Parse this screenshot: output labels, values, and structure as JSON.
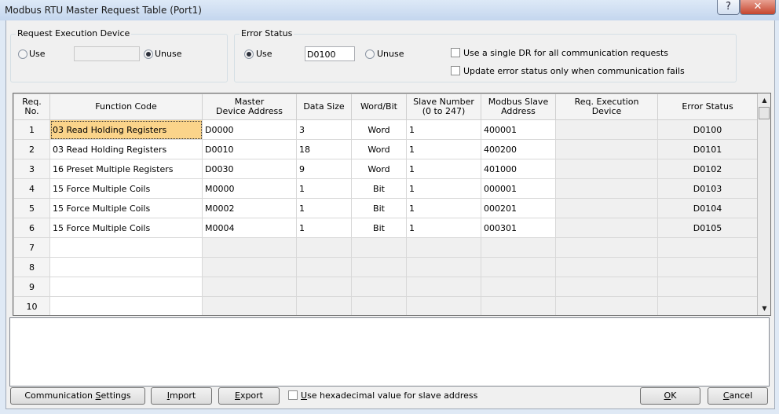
{
  "window": {
    "title": "Modbus RTU Master Request Table (Port1)",
    "help_label": "?",
    "close_label": "✕"
  },
  "request_execution_device": {
    "legend": "Request Execution Device",
    "use_label": "Use",
    "unuse_label": "Unuse",
    "device_value": ""
  },
  "error_status": {
    "legend": "Error Status",
    "use_label": "Use",
    "unuse_label": "Unuse",
    "device_value": "D0100",
    "single_dr_label": "Use a single DR for all communication requests",
    "update_fail_label": "Update error status only when communication fails"
  },
  "table": {
    "headers": {
      "req_no": [
        "Req.",
        "No."
      ],
      "function_code": "Function Code",
      "master_addr": [
        "Master",
        "Device Address"
      ],
      "data_size": "Data Size",
      "word_bit": "Word/Bit",
      "slave_number": [
        "Slave Number",
        "(0 to 247)"
      ],
      "modbus_slave": [
        "Modbus Slave",
        "Address"
      ],
      "req_exec": [
        "Req. Execution",
        "Device"
      ],
      "error_status": "Error Status"
    },
    "rows": [
      {
        "no": "1",
        "function": "03 Read Holding Registers",
        "master": "D0000",
        "size": "3",
        "wordbit": "Word",
        "slave": "1",
        "modbus": "400001",
        "req": "",
        "err": "D0100"
      },
      {
        "no": "2",
        "function": "03 Read Holding Registers",
        "master": "D0010",
        "size": "18",
        "wordbit": "Word",
        "slave": "1",
        "modbus": "400200",
        "req": "",
        "err": "D0101"
      },
      {
        "no": "3",
        "function": "16 Preset Multiple Registers",
        "master": "D0030",
        "size": "9",
        "wordbit": "Word",
        "slave": "1",
        "modbus": "401000",
        "req": "",
        "err": "D0102"
      },
      {
        "no": "4",
        "function": "15 Force Multiple Coils",
        "master": "M0000",
        "size": "1",
        "wordbit": "Bit",
        "slave": "1",
        "modbus": "000001",
        "req": "",
        "err": "D0103"
      },
      {
        "no": "5",
        "function": "15 Force Multiple Coils",
        "master": "M0002",
        "size": "1",
        "wordbit": "Bit",
        "slave": "1",
        "modbus": "000201",
        "req": "",
        "err": "D0104"
      },
      {
        "no": "6",
        "function": "15 Force Multiple Coils",
        "master": "M0004",
        "size": "1",
        "wordbit": "Bit",
        "slave": "1",
        "modbus": "000301",
        "req": "",
        "err": "D0105"
      },
      {
        "no": "7",
        "function": "",
        "master": "",
        "size": "",
        "wordbit": "",
        "slave": "",
        "modbus": "",
        "req": "",
        "err": ""
      },
      {
        "no": "8",
        "function": "",
        "master": "",
        "size": "",
        "wordbit": "",
        "slave": "",
        "modbus": "",
        "req": "",
        "err": ""
      },
      {
        "no": "9",
        "function": "",
        "master": "",
        "size": "",
        "wordbit": "",
        "slave": "",
        "modbus": "",
        "req": "",
        "err": ""
      },
      {
        "no": "10",
        "function": "",
        "master": "",
        "size": "",
        "wordbit": "",
        "slave": "",
        "modbus": "",
        "req": "",
        "err": ""
      }
    ]
  },
  "buttons": {
    "comm_settings": {
      "pre": "Communication ",
      "mn": "S",
      "post": "ettings"
    },
    "import": {
      "pre": "",
      "mn": "I",
      "post": "mport"
    },
    "export": {
      "pre": "",
      "mn": "E",
      "post": "xport"
    },
    "ok": {
      "pre": "",
      "mn": "O",
      "post": "K"
    },
    "cancel": {
      "pre": "",
      "mn": "C",
      "post": "ancel"
    }
  },
  "hex_checkbox": {
    "pre": "",
    "mn": "U",
    "post": "se hexadecimal value for slave address"
  }
}
